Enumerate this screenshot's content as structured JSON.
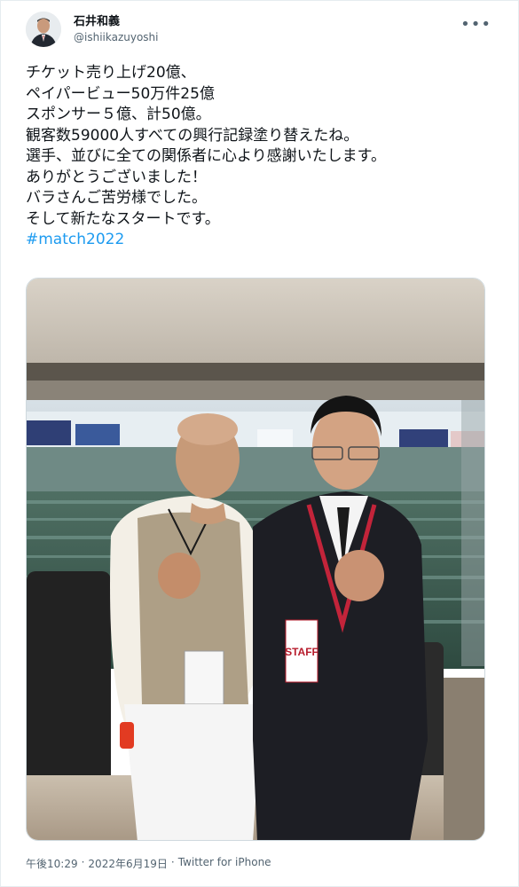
{
  "user": {
    "display_name": "石井和義",
    "handle": "@ishiikazuyoshi",
    "avatar_icon": "person-avatar-icon"
  },
  "menu_icon": "more-options-icon",
  "tweet": {
    "lines": [
      "チケット売り上げ20億、",
      "ペイパービュー50万件25億",
      "スポンサー５億、計50億。",
      "観客数59000人すべての興行記録塗り替えたね。",
      "選手、並びに全ての関係者に心より感謝いたします。",
      "ありがとうございました！",
      "バラさんご苦労様でした。",
      "そして新たなスタートです。"
    ],
    "hashtag": "#match2022"
  },
  "photo": {
    "badge_text": "STAFF",
    "brand_color": "#1d9bf0"
  },
  "footer": {
    "time": "午後10:29",
    "separator": "·",
    "date": "2022年6月19日",
    "source": "Twitter for iPhone"
  }
}
